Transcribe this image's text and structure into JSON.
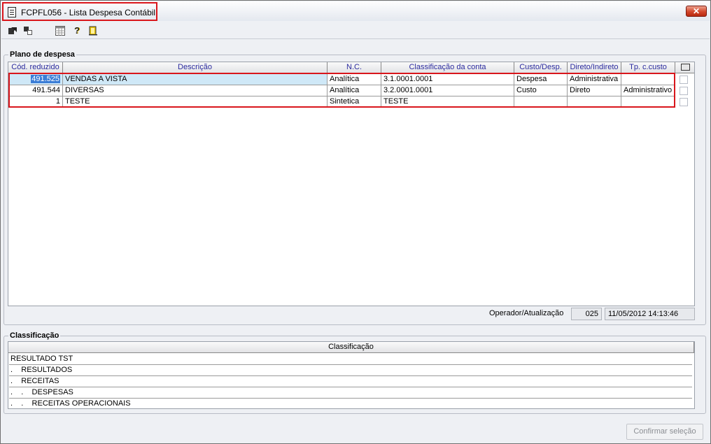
{
  "window": {
    "title": "FCPFL056 - Lista Despesa Contábil",
    "close_label": "✕"
  },
  "toolbar": {
    "icons": [
      "export-icon",
      "copy-icon",
      "grid-icon",
      "help-icon",
      "exit-door-icon"
    ]
  },
  "plano": {
    "group_label": "Plano de despesa",
    "columns": [
      "Cód. reduzido",
      "Descrição",
      "N.C.",
      "Classificação da conta",
      "Custo/Desp.",
      "Direto/Indireto",
      "Tp. c.custo"
    ],
    "rows": [
      {
        "cod": "491.525",
        "descricao": "VENDAS A VISTA",
        "nc": "Analítica",
        "classificacao": "3.1.0001.0001",
        "custo": "Despesa",
        "direto": "Administrativa",
        "tp": ""
      },
      {
        "cod": "491.544",
        "descricao": "DIVERSAS",
        "nc": "Analítica",
        "classificacao": "3.2.0001.0001",
        "custo": "Custo",
        "direto": "Direto",
        "tp": "Administrativo"
      },
      {
        "cod": "1",
        "descricao": "TESTE",
        "nc": "Sintetica",
        "classificacao": "TESTE",
        "custo": "",
        "direto": "",
        "tp": ""
      }
    ]
  },
  "status": {
    "label": "Operador/Atualização",
    "operador": "025",
    "data": "11/05/2012 14:13:46"
  },
  "classificacao": {
    "group_label": "Classificação",
    "header": "Classificação",
    "rows": [
      "RESULTADO TST",
      ".    RESULTADOS",
      ".    RECEITAS",
      ".    .    DESPESAS",
      ".    .    RECEITAS OPERACIONAIS"
    ]
  },
  "confirm_label": "Confirmar seleção"
}
